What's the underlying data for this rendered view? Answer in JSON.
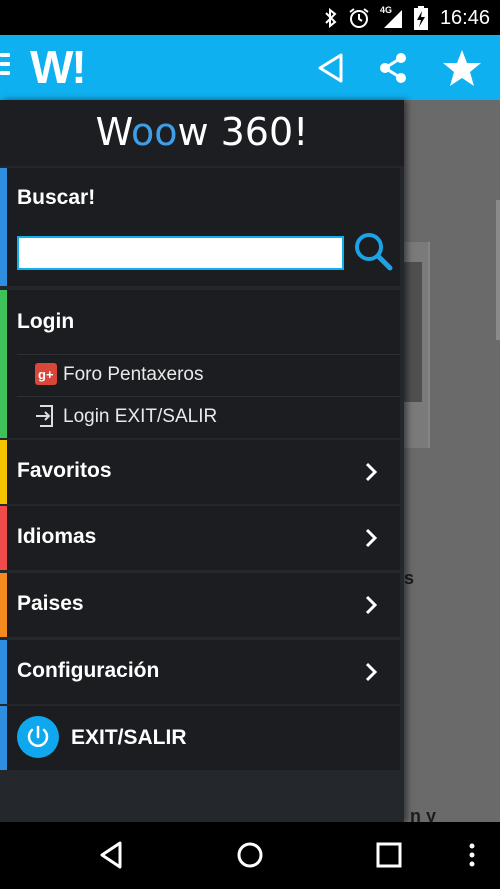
{
  "status_bar": {
    "time": "16:46",
    "network": "4G",
    "icons": [
      "bluetooth-icon",
      "alarm-icon",
      "signal-icon",
      "battery-charging-icon"
    ]
  },
  "app_bar": {
    "logo": "W!",
    "actions": [
      "back-triangle-icon",
      "share-icon",
      "star-icon"
    ]
  },
  "drawer": {
    "logo_prefix": "W",
    "logo_oo": "oo",
    "logo_suffix": "w 360!",
    "search": {
      "title": "Buscar!",
      "placeholder": "",
      "value": ""
    },
    "login": {
      "title": "Login",
      "items": [
        {
          "label": "Foro Pentaxeros",
          "icon": "google-plus-icon"
        },
        {
          "label": "Login EXIT/SALIR",
          "icon": "login-exit-icon"
        }
      ]
    },
    "menu": [
      {
        "label": "Favoritos",
        "accent": "#f5c400"
      },
      {
        "label": "Idiomas",
        "accent": "#f04b4b"
      },
      {
        "label": "Paises",
        "accent": "#f58a1f"
      },
      {
        "label": "Configuración",
        "accent": "#2f8ee0"
      }
    ],
    "exit": {
      "label": "EXIT/SALIR",
      "accent": "#2f8ee0"
    },
    "accents": {
      "search": "#2f8ee0",
      "login": "#3fc25a"
    }
  },
  "background": {
    "fragment_1": "s",
    "fragment_2": "n y"
  },
  "colors": {
    "app_bar": "#0fb0f0",
    "drawer_bg": "#24272b",
    "section_bg": "#1b1d20"
  }
}
